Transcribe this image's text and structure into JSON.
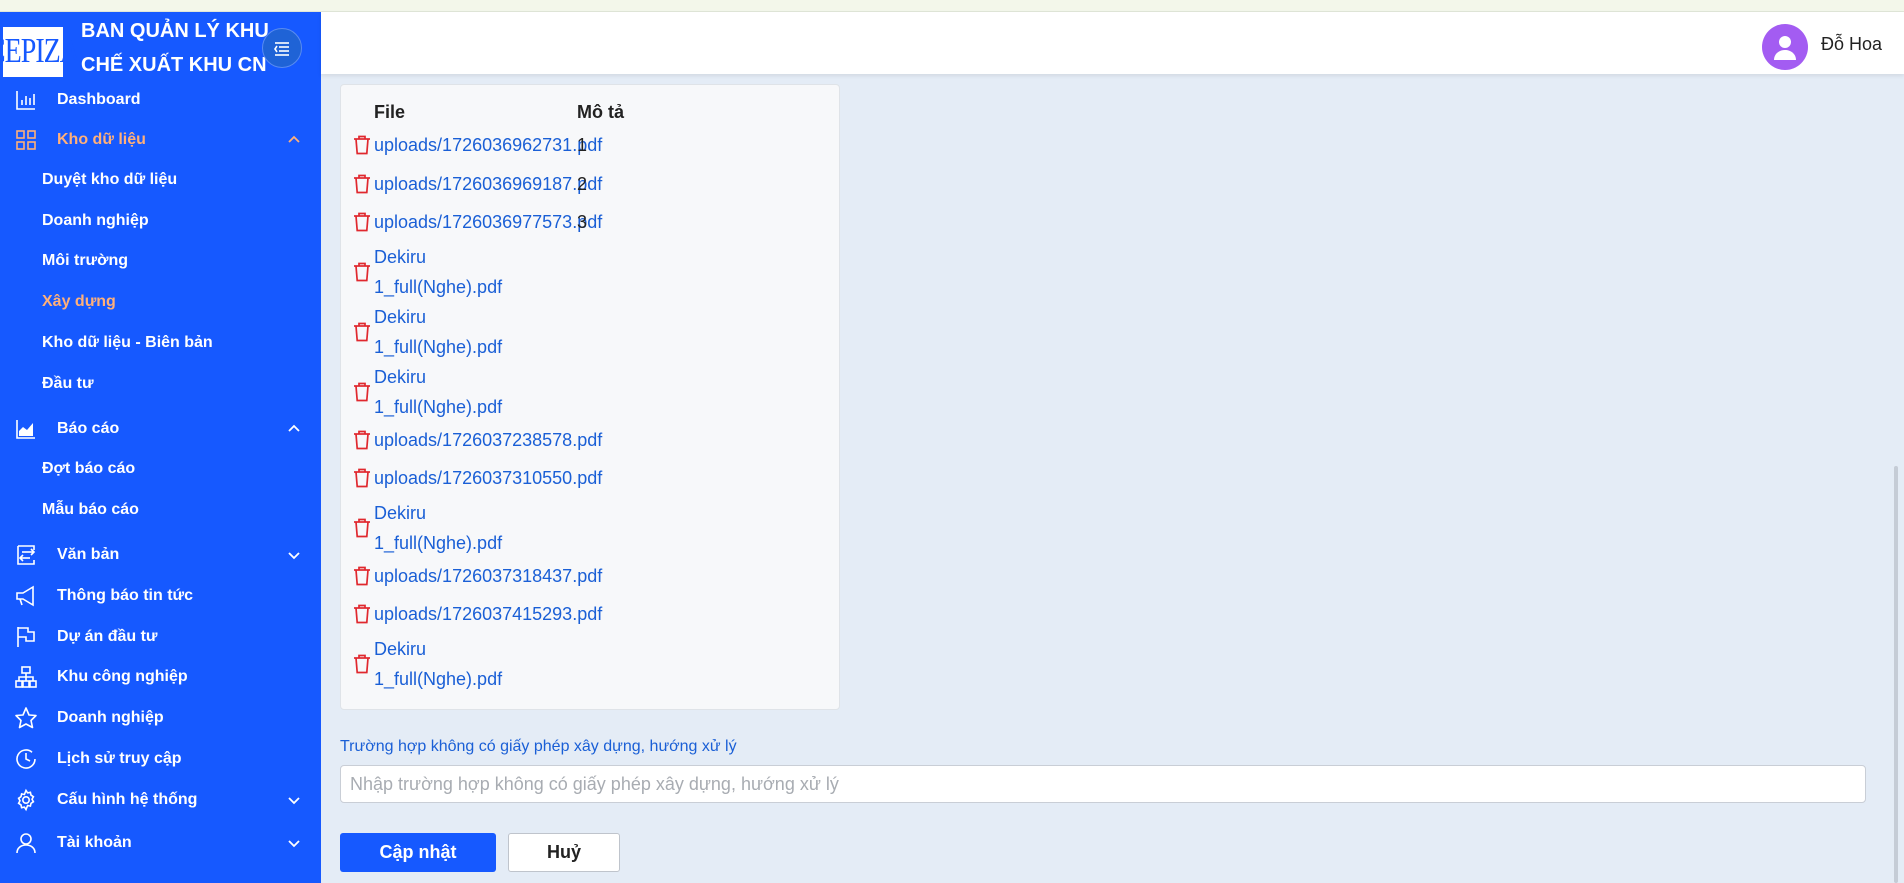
{
  "brand": {
    "logo_text": "CEPIZA",
    "title_line1": "BAN QUẢN LÝ KHU",
    "title_line2": "CHẾ XUẤT KHU CN"
  },
  "user": {
    "name": "Đỗ Hoa"
  },
  "sidebar": {
    "items": [
      {
        "label": "Dashboard",
        "icon": "chart-bar-icon"
      },
      {
        "label": "Kho dữ liệu",
        "icon": "grid-icon",
        "expanded": true,
        "active": true
      },
      {
        "label": "Báo cáo",
        "icon": "area-chart-icon",
        "expanded": true
      },
      {
        "label": "Văn bản",
        "icon": "transfer-icon",
        "expanded": false
      },
      {
        "label": "Thông báo tin tức",
        "icon": "megaphone-icon"
      },
      {
        "label": "Dự án đầu tư",
        "icon": "flag-icon"
      },
      {
        "label": "Khu công nghiệp",
        "icon": "cluster-icon"
      },
      {
        "label": "Doanh nghiệp",
        "icon": "star-icon"
      },
      {
        "label": "Lịch sử truy cập",
        "icon": "clock-icon"
      },
      {
        "label": "Cấu hình hệ thống",
        "icon": "gear-icon",
        "expanded": false
      },
      {
        "label": "Tài khoản",
        "icon": "user-icon",
        "expanded": false
      }
    ],
    "kho_sub": [
      {
        "label": "Duyệt kho dữ liệu"
      },
      {
        "label": "Doanh nghiệp"
      },
      {
        "label": "Môi trường"
      },
      {
        "label": "Xây dựng",
        "active": true
      },
      {
        "label": "Kho dữ liệu - Biên bản"
      },
      {
        "label": "Đầu tư"
      }
    ],
    "baocao_sub": [
      {
        "label": "Đợt báo cáo"
      },
      {
        "label": "Mẫu báo cáo"
      }
    ]
  },
  "files": {
    "col_file": "File",
    "col_desc": "Mô tả",
    "rows": [
      {
        "file": "uploads/1726036962731.pdf",
        "desc": "1"
      },
      {
        "file": "uploads/1726036969187.pdf",
        "desc": "2"
      },
      {
        "file": "uploads/1726036977573.pdf",
        "desc": "3"
      },
      {
        "file": "Dekiru 1_full(Nghe).pdf",
        "desc": ""
      },
      {
        "file": "Dekiru 1_full(Nghe).pdf",
        "desc": ""
      },
      {
        "file": "Dekiru 1_full(Nghe).pdf",
        "desc": ""
      },
      {
        "file": "uploads/1726037238578.pdf",
        "desc": ""
      },
      {
        "file": "uploads/1726037310550.pdf",
        "desc": ""
      },
      {
        "file": "Dekiru 1_full(Nghe).pdf",
        "desc": ""
      },
      {
        "file": "uploads/1726037318437.pdf",
        "desc": ""
      },
      {
        "file": "uploads/1726037415293.pdf",
        "desc": ""
      },
      {
        "file": "Dekiru 1_full(Nghe).pdf",
        "desc": ""
      }
    ]
  },
  "form": {
    "label": "Trường hợp không có giấy phép xây dựng, hướng xử lý",
    "value": "",
    "placeholder": "Nhập trường hợp không có giấy phép xây dựng, hướng xử lý"
  },
  "actions": {
    "update_label": "Cập nhật",
    "cancel_label": "Huỷ"
  },
  "colors": {
    "sidebar": "#1659ff",
    "active_text": "#ffb07a",
    "link": "#1a5fd6",
    "trash": "#e0282e",
    "avatar": "#a35cf2"
  }
}
